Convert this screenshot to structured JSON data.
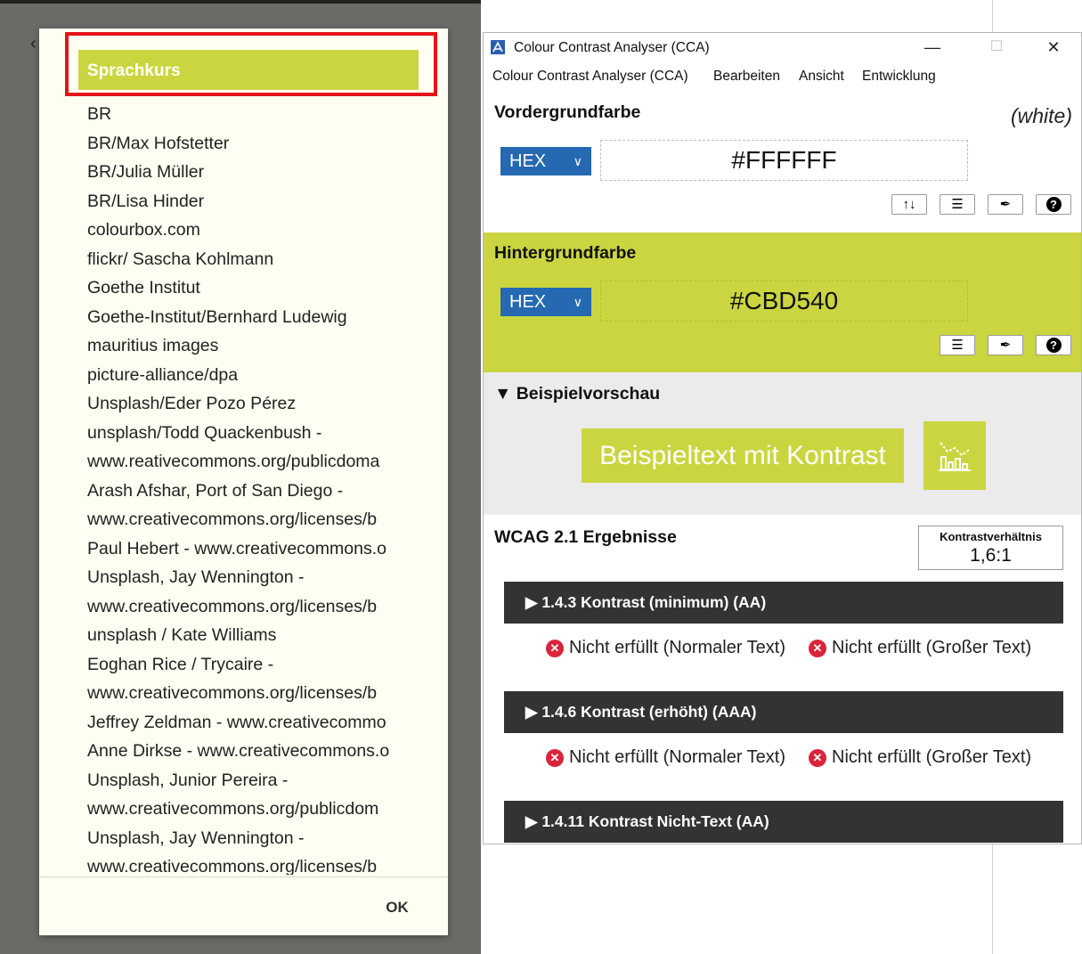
{
  "dialog": {
    "title": "Sprachkurs",
    "credits": [
      "BR",
      "BR/Max Hofstetter",
      "BR/Julia Müller",
      "BR/Lisa Hinder",
      "colourbox.com",
      "flickr/ Sascha Kohlmann",
      "Goethe Institut",
      "Goethe-Institut/Bernhard Ludewig",
      "mauritius images",
      "picture-alliance/dpa",
      "Unsplash/Eder Pozo Pérez",
      "unsplash/Todd Quackenbush -",
      "www.reativecommons.org/publicdoma",
      "Arash Afshar, Port of San Diego -",
      "www.creativecommons.org/licenses/b",
      "Paul Hebert - www.creativecommons.o",
      "Unsplash, Jay Wennington -",
      "www.creativecommons.org/licenses/b",
      "unsplash / Kate Williams",
      "Eoghan Rice / Trycaire -",
      "www.creativecommons.org/licenses/b",
      "Jeffrey Zeldman - www.creativecommo",
      "Anne Dirkse - www.creativecommons.o",
      "Unsplash, Junior Pereira -",
      "www.creativecommons.org/publicdom",
      "Unsplash, Jay Wennington -",
      "www.creativecommons.org/licenses/b"
    ],
    "ok_label": "OK"
  },
  "cca": {
    "window_title": "Colour Contrast Analyser (CCA)",
    "window_controls": {
      "minimize": "—",
      "maximize": "☐",
      "close": "✕"
    },
    "menu": [
      "Colour Contrast Analyser (CCA)",
      "Bearbeiten",
      "Ansicht",
      "Entwicklung"
    ],
    "foreground": {
      "heading": "Vordergrundfarbe",
      "color_name": "(white)",
      "format": "HEX",
      "value": "#FFFFFF",
      "tools": [
        "swap-icon",
        "sliders-icon",
        "eyedropper-icon",
        "help-icon"
      ]
    },
    "background": {
      "heading": "Hintergrundfarbe",
      "format": "HEX",
      "value": "#CBD540",
      "tools": [
        "sliders-icon",
        "eyedropper-icon",
        "help-icon"
      ]
    },
    "preview": {
      "heading": "▼ Beispielvorschau",
      "sample_text": "Beispieltext mit Kontrast"
    },
    "wcag": {
      "heading": "WCAG 2.1 Ergebnisse",
      "ratio_label": "Kontrastverhältnis",
      "ratio_value": "1,6:1",
      "criteria": [
        {
          "title": "▶  1.4.3 Kontrast (minimum) (AA)",
          "normal": "Nicht erfüllt (Normaler Text)",
          "large": "Nicht erfüllt (Großer Text)"
        },
        {
          "title": "▶  1.4.6 Kontrast (erhöht) (AAA)",
          "normal": "Nicht erfüllt (Normaler Text)",
          "large": "Nicht erfüllt (Großer Text)"
        },
        {
          "title": "▶  1.4.11 Kontrast Nicht-Text (AA)"
        }
      ]
    }
  },
  "colors": {
    "accent_green": "#CBD540",
    "hex_select_blue": "#2469B1",
    "criteria_bar": "#333333",
    "fail_red": "#D9253C",
    "highlight_red": "#E3141B"
  }
}
